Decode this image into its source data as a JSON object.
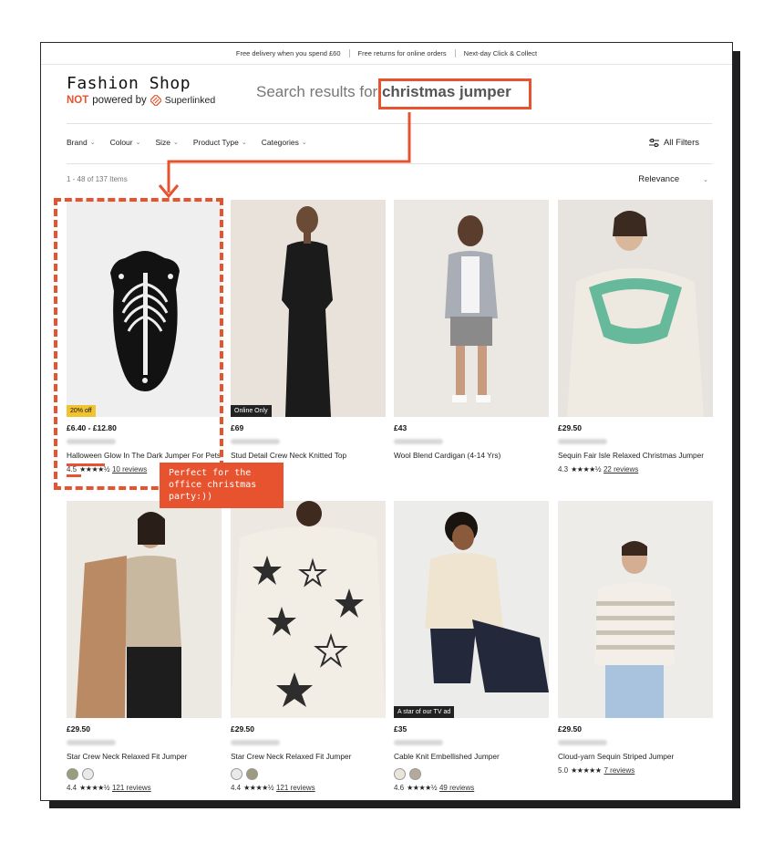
{
  "topbar": {
    "item1": "Free delivery when you spend £60",
    "item2": "Free returns for online orders",
    "item3": "Next-day Click & Collect"
  },
  "brand": {
    "name": "Fashion Shop",
    "not": "NOT",
    "powered_by": "powered by",
    "partner": "Superlinked"
  },
  "search": {
    "prefix": "Search results for",
    "query": "christmas jumper"
  },
  "filters": [
    "Brand",
    "Colour",
    "Size",
    "Product Type",
    "Categories"
  ],
  "all_filters": "All Filters",
  "result_count": "1 - 48 of 137 Items",
  "sort": "Relevance",
  "annotation": "Perfect for the office christmas party:))",
  "accent": "#e8532f",
  "products": [
    {
      "price": "£6.40 - £12.80",
      "name": "Halloween Glow In The Dark Jumper For Pets",
      "badge": "20% off",
      "rating": "4.5",
      "stars": "★★★★½",
      "reviews": "10 reviews"
    },
    {
      "price": "£69",
      "name": "Stud Detail Crew Neck Knitted Top",
      "badge": "Online Only"
    },
    {
      "price": "£43",
      "name": "Wool Blend Cardigan (4-14 Yrs)"
    },
    {
      "price": "£29.50",
      "name": "Sequin Fair Isle Relaxed Christmas Jumper",
      "rating": "4.3",
      "stars": "★★★★½",
      "reviews": "22 reviews"
    },
    {
      "price": "£29.50",
      "name": "Star Crew Neck Relaxed Fit Jumper",
      "rating": "4.4",
      "stars": "★★★★½",
      "reviews": "121 reviews"
    },
    {
      "price": "£29.50",
      "name": "Star Crew Neck Relaxed Fit Jumper",
      "rating": "4.4",
      "stars": "★★★★½",
      "reviews": "121 reviews"
    },
    {
      "price": "£35",
      "name": "Cable Knit Embellished Jumper",
      "badge": "A star of our TV ad",
      "rating": "4.6",
      "stars": "★★★★½",
      "reviews": "49 reviews"
    },
    {
      "price": "£29.50",
      "name": "Cloud-yarn Sequin Striped Jumper",
      "rating": "5.0",
      "stars": "★★★★★",
      "reviews": "7 reviews"
    }
  ]
}
